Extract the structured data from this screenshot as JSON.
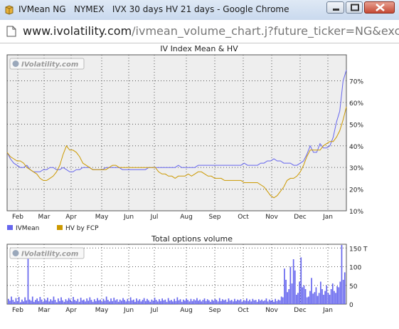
{
  "window": {
    "title": "IVMean NG   NYMEX   IVX 30 days HV 21 days - Google Chrome"
  },
  "address_bar": {
    "url_host": "www.ivolatility.com",
    "url_rest": "/ivmean_volume_chart.j?future_ticker=NG&exchange=N"
  },
  "watermark": "IVolatility.com",
  "colors": {
    "ivmean": "#6666ee",
    "hv": "#cc9900",
    "volume": "#6666ee",
    "plot_bg": "#eeeeee"
  },
  "chart_data": [
    {
      "type": "line",
      "title": "IV Index Mean & HV",
      "x_labels": [
        "Feb",
        "Mar",
        "Apr",
        "May",
        "Jun",
        "Jul",
        "Aug",
        "Sep",
        "Oct",
        "Nov",
        "Dec",
        "Jan"
      ],
      "y_ticks": [
        "10%",
        "20%",
        "30%",
        "40%",
        "50%",
        "60%",
        "70%"
      ],
      "ylim": [
        10,
        82
      ],
      "ylabel_position": "right",
      "grid": true,
      "legend": {
        "placement": "bottom-left"
      },
      "series": [
        {
          "name": "IVMean",
          "values": [
            37,
            34,
            32,
            31,
            30,
            30,
            31,
            29,
            28,
            28,
            28,
            29,
            29,
            30,
            30,
            29,
            29,
            30,
            29,
            28,
            28,
            29,
            29,
            30,
            30,
            30,
            29,
            29,
            29,
            29,
            30,
            30,
            30,
            30,
            30,
            29,
            29,
            29,
            29,
            29,
            29,
            29,
            29,
            30,
            30,
            30,
            30,
            30,
            30,
            30,
            30,
            30,
            31,
            30,
            30,
            30,
            30,
            30,
            31,
            31,
            31,
            31,
            31,
            31,
            31,
            31,
            31,
            31,
            31,
            31,
            31,
            31,
            32,
            31,
            31,
            31,
            31,
            32,
            32,
            33,
            33,
            34,
            33,
            33,
            32,
            32,
            32,
            31,
            31,
            32,
            33,
            36,
            40,
            37,
            37,
            41,
            39,
            39,
            40,
            44,
            51,
            56,
            70,
            75
          ]
        },
        {
          "name": "HV by FCP",
          "values": [
            37,
            35,
            34,
            33,
            33,
            32,
            30,
            29,
            28,
            27,
            25,
            24,
            24,
            25,
            26,
            28,
            31,
            36,
            40,
            38,
            38,
            37,
            35,
            32,
            31,
            30,
            29,
            29,
            29,
            29,
            29,
            30,
            31,
            31,
            30,
            30,
            30,
            30,
            30,
            30,
            30,
            30,
            30,
            30,
            30,
            30,
            28,
            27,
            27,
            26,
            26,
            25,
            26,
            26,
            26,
            27,
            26,
            27,
            28,
            28,
            27,
            26,
            26,
            25,
            25,
            25,
            24,
            24,
            24,
            24,
            24,
            24,
            23,
            23,
            23,
            23,
            23,
            22,
            21,
            19,
            17,
            16,
            17,
            19,
            21,
            24,
            25,
            25,
            26,
            28,
            31,
            35,
            38,
            38,
            38,
            38,
            40,
            41,
            42,
            42,
            44,
            47,
            52,
            58
          ]
        }
      ]
    },
    {
      "type": "bar",
      "title": "Total options volume",
      "x_labels": [
        "Feb",
        "Mar",
        "Apr",
        "May",
        "Jun",
        "Jul",
        "Aug",
        "Sep",
        "Oct",
        "Nov",
        "Dec",
        "Jan"
      ],
      "y_ticks": [
        "0",
        "50",
        "100",
        "150 T"
      ],
      "ylim": [
        0,
        160
      ],
      "grid": true,
      "series": [
        {
          "name": "Total options volume",
          "values": [
            14,
            9,
            20,
            11,
            6,
            16,
            8,
            19,
            5,
            12,
            7,
            18,
            10,
            140,
            12,
            9,
            20,
            6,
            11,
            15,
            8,
            19,
            12,
            6,
            14,
            10,
            17,
            7,
            13,
            9,
            20,
            11,
            5,
            15,
            8,
            18,
            10,
            6,
            13,
            9,
            16,
            12,
            7,
            19,
            11,
            8,
            14,
            6,
            17,
            10,
            12,
            7,
            15,
            9,
            18,
            11,
            6,
            13,
            8,
            16,
            10,
            12,
            6,
            14,
            9,
            20,
            11,
            7,
            15,
            8,
            17,
            10,
            13,
            6,
            12,
            9,
            16,
            11,
            7,
            14,
            8,
            18,
            10,
            12,
            6,
            15,
            9,
            13,
            7,
            11,
            16,
            8,
            14,
            10,
            6,
            12,
            9,
            17,
            11,
            7,
            13,
            8,
            15,
            10,
            12,
            6,
            16,
            9,
            11,
            7,
            14,
            8,
            18,
            10,
            13,
            6,
            12,
            9,
            15,
            11,
            7,
            14,
            8,
            13,
            10,
            16,
            9,
            12,
            7,
            11,
            15,
            8,
            13,
            10,
            6,
            12,
            9,
            14,
            11,
            7,
            16,
            8,
            13,
            10,
            12,
            6,
            15,
            9,
            11,
            7,
            14,
            8,
            12,
            10,
            13,
            6,
            11,
            9,
            15,
            8,
            12,
            7,
            14,
            10,
            11,
            6,
            13,
            9,
            12,
            8,
            10,
            15,
            7,
            12,
            9,
            11,
            6,
            14,
            8,
            12,
            10,
            20,
            18,
            95,
            65,
            32,
            40,
            100,
            55,
            120,
            90,
            25,
            30,
            60,
            125,
            45,
            50,
            40,
            18,
            20,
            35,
            70,
            28,
            32,
            45,
            22,
            30,
            60,
            40,
            25,
            35,
            50,
            30,
            25,
            40,
            55,
            35,
            30,
            48,
            45,
            60,
            170,
            65,
            85
          ]
        }
      ]
    }
  ]
}
